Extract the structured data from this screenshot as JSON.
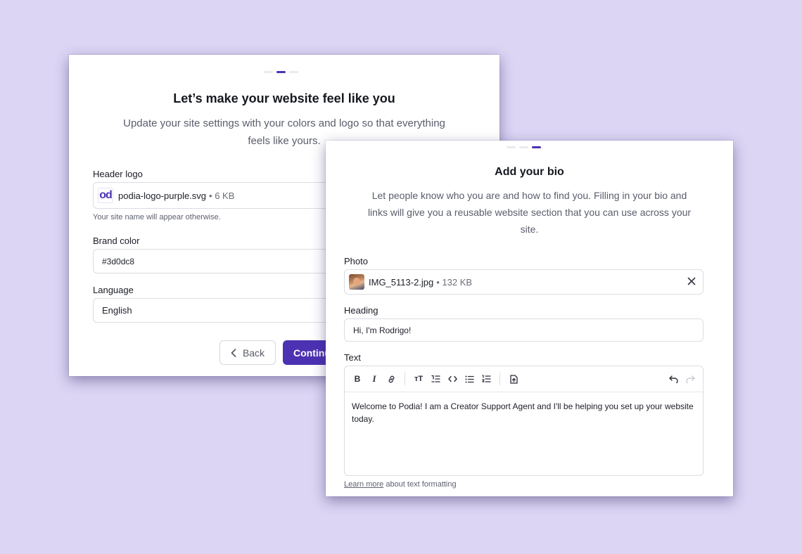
{
  "website_step": {
    "title": "Let’s make your website feel like you",
    "description": "Update your site settings with your colors and logo so that everything feels like yours.",
    "header_logo": {
      "label": "Header logo",
      "file_name": "podia-logo-purple.svg",
      "file_size": "• 6 KB",
      "hint": "Your site name will appear otherwise.",
      "logo_text": "od"
    },
    "brand_color": {
      "label": "Brand color",
      "value": "#3d0dc8"
    },
    "language": {
      "label": "Language",
      "value": "English"
    },
    "back_button": "Back",
    "continue_button": "Continue"
  },
  "bio_step": {
    "title": "Add your bio",
    "description": "Let people know who you are and how to find you. Filling in your bio and links will give you a reusable website section that you can use across your site.",
    "photo": {
      "label": "Photo",
      "file_name": "IMG_5113-2.jpg",
      "file_size": "• 132 KB"
    },
    "heading": {
      "label": "Heading",
      "value": "Hi, I'm Rodrigo!"
    },
    "text": {
      "label": "Text",
      "value": "Welcome to Podia! I am a Creator Support Agent and I'll be helping you set up your website today.",
      "learn_more_link": "Learn more",
      "learn_more_suffix": "about text formatting"
    },
    "toolbar_icons": [
      "bold-icon",
      "italic-icon",
      "link-icon",
      "text-size-icon",
      "numbered-heading-icon",
      "code-icon",
      "bulleted-list-icon",
      "numbered-list-icon",
      "insert-file-icon",
      "undo-icon",
      "redo-icon"
    ]
  },
  "colors": {
    "background": "#dcd5f4",
    "accent": "#4c32b3"
  }
}
